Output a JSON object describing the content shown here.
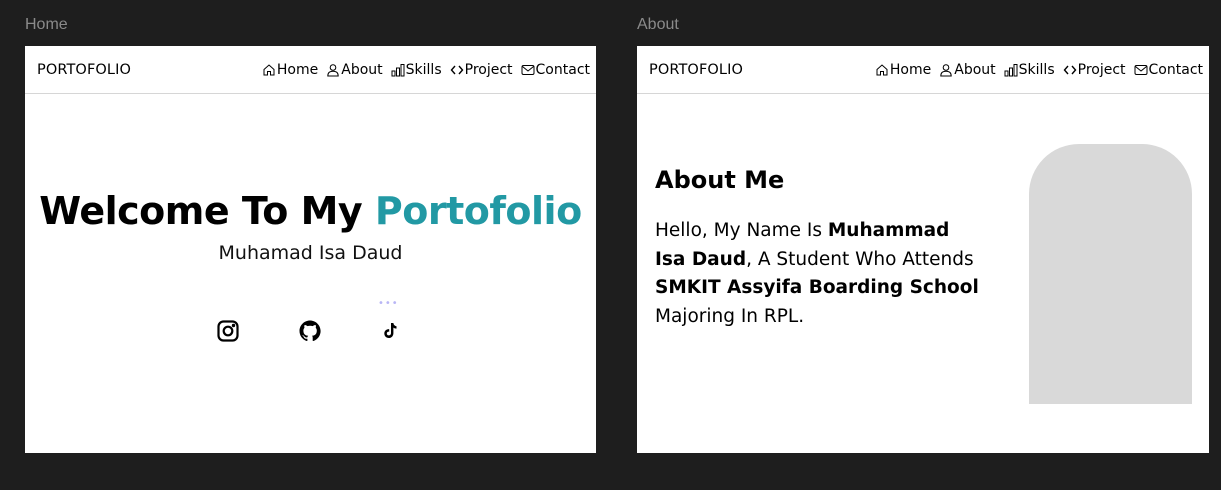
{
  "frames": {
    "home": {
      "label": "Home",
      "navbar": {
        "brand": "PORTOFOLIO",
        "items": [
          {
            "label": "Home",
            "icon": "home-icon"
          },
          {
            "label": "About",
            "icon": "user-icon"
          },
          {
            "label": "Skills",
            "icon": "bar-chart-icon"
          },
          {
            "label": "Project",
            "icon": "code-icon"
          },
          {
            "label": "Contact",
            "icon": "mail-icon"
          }
        ]
      },
      "hero": {
        "title_prefix": "Welcome To My ",
        "title_accent": "Portofolio",
        "subtitle": "Muhamad Isa Daud",
        "dots": "•••",
        "accent_color": "#2299a4"
      },
      "socials": [
        "instagram-icon",
        "github-icon",
        "tiktok-icon"
      ]
    },
    "about": {
      "label": "About",
      "navbar": {
        "brand": "PORTOFOLIO",
        "items": [
          {
            "label": "Home",
            "icon": "home-icon"
          },
          {
            "label": "About",
            "icon": "user-icon"
          },
          {
            "label": "Skills",
            "icon": "bar-chart-icon"
          },
          {
            "label": "Project",
            "icon": "code-icon"
          },
          {
            "label": "Contact",
            "icon": "mail-icon"
          }
        ]
      },
      "heading": "About Me",
      "bio": {
        "part1": "Hello, My Name Is ",
        "name": "Muhammad Isa Daud",
        "part2": ", A Student Who Attends ",
        "school": "SMKIT Assyifa Boarding School",
        "part3": " Majoring In RPL."
      },
      "photo_placeholder_color": "#d9d9d9"
    }
  }
}
